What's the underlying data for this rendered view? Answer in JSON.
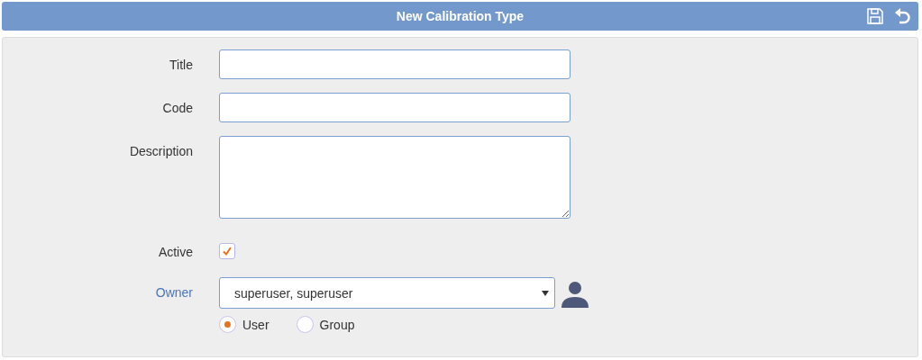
{
  "header": {
    "title": "New Calibration Type"
  },
  "fields": [
    {
      "kind": "text",
      "label": "Title"
    },
    {
      "kind": "text",
      "label": "Code"
    },
    {
      "kind": "textarea",
      "label": "Description"
    },
    {
      "kind": "checkbox",
      "label": "Active",
      "checked": true
    },
    {
      "kind": "owner",
      "label": "Owner",
      "value": "superuser, superuser",
      "options": [
        {
          "label": "User",
          "selected": true
        },
        {
          "label": "Group",
          "selected": false
        }
      ]
    }
  ]
}
